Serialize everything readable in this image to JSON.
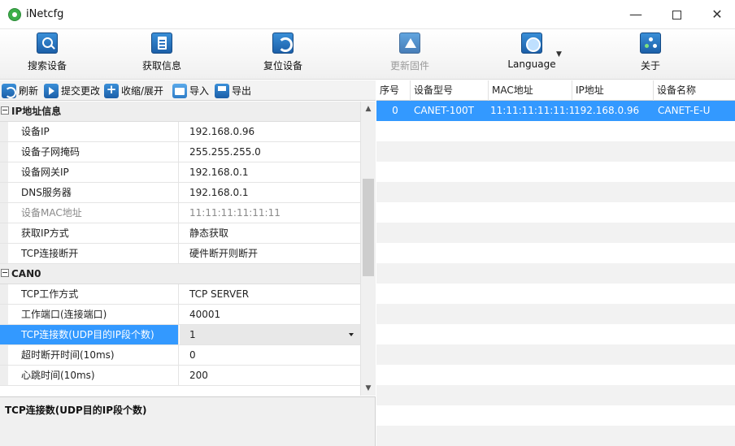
{
  "window": {
    "title": "iNetcfg",
    "minimize_glyph": "—",
    "close_glyph": "✕"
  },
  "toolbar": {
    "search": "搜索设备",
    "get_info": "获取信息",
    "reset": "复位设备",
    "update_firmware": "更新固件",
    "language": "Language",
    "about": "关于"
  },
  "subtoolbar": {
    "refresh": "刷新",
    "submit": "提交更改",
    "collapse_expand": "收缩/展开",
    "import": "导入",
    "export": "导出"
  },
  "property_grid": {
    "categories": {
      "ip": "IP地址信息",
      "can0": "CAN0"
    },
    "ip_rows": [
      {
        "name": "设备IP",
        "value": "192.168.0.96"
      },
      {
        "name": "设备子网掩码",
        "value": "255.255.255.0"
      },
      {
        "name": "设备网关IP",
        "value": "192.168.0.1"
      },
      {
        "name": "DNS服务器",
        "value": "192.168.0.1"
      },
      {
        "name": "设备MAC地址",
        "value": "11:11:11:11:11:11"
      },
      {
        "name": "获取IP方式",
        "value": "静态获取"
      },
      {
        "name": "TCP连接断开",
        "value": "硬件断开则断开"
      }
    ],
    "can0_rows": [
      {
        "name": "TCP工作方式",
        "value": "TCP SERVER"
      },
      {
        "name": "工作端口(连接端口)",
        "value": "40001"
      },
      {
        "name": "TCP连接数(UDP目的IP段个数)",
        "value": "1"
      },
      {
        "name": "超时断开时间(10ms)",
        "value": "0"
      },
      {
        "name": "心跳时间(10ms)",
        "value": "200"
      }
    ],
    "description_title": "TCP连接数(UDP目的IP段个数)",
    "scroll_up_glyph": "▲",
    "scroll_down_glyph": "▼"
  },
  "device_list": {
    "columns": [
      "序号",
      "设备型号",
      "MAC地址",
      "IP地址",
      "设备名称"
    ],
    "rows": [
      {
        "index": "0",
        "model": "CANET-100T",
        "mac": "11:11:11:11:11:11",
        "ip": "192.168.0.96",
        "name": "CANET-E-U"
      }
    ]
  }
}
